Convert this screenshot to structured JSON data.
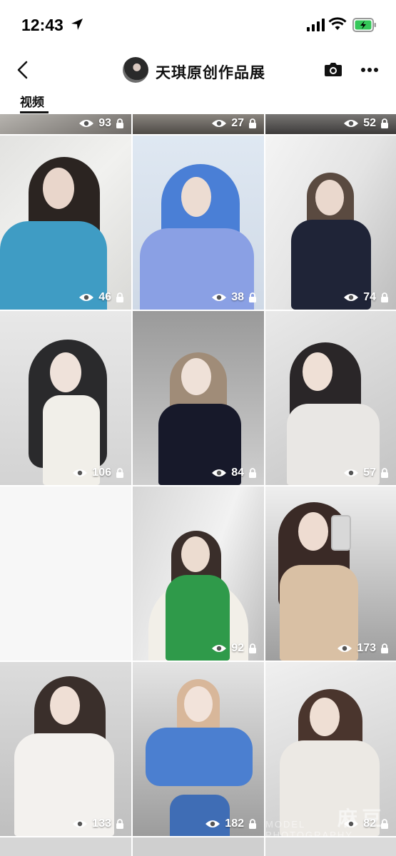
{
  "status_bar": {
    "time": "12:43"
  },
  "header": {
    "title": "天琪原创作品展"
  },
  "tabs": [
    {
      "label": "视频",
      "active": true
    }
  ],
  "grid": [
    {
      "views": "93"
    },
    {
      "views": "27"
    },
    {
      "views": "52"
    },
    {
      "views": "46"
    },
    {
      "views": "38"
    },
    {
      "views": "74"
    },
    {
      "views": "106"
    },
    {
      "views": "84"
    },
    {
      "views": "57"
    },
    {
      "views": ""
    },
    {
      "views": "92"
    },
    {
      "views": "173"
    },
    {
      "views": "133"
    },
    {
      "views": "182"
    },
    {
      "views": "82"
    }
  ],
  "watermark": {
    "text": "麻豆",
    "subtext": "MODEL PHOTOGRAPHY"
  },
  "colors": {
    "accent": "#111111",
    "battery": "#35c759",
    "background": "#ffffff"
  }
}
